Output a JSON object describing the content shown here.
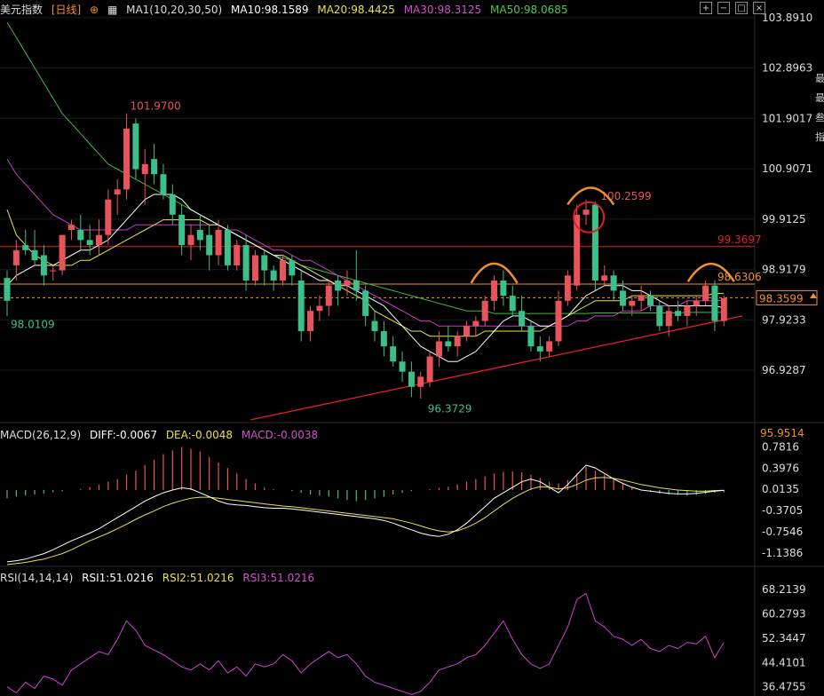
{
  "header": {
    "symbol": "美元指数",
    "period": "[日线]",
    "ma_label": "MA1(10,20,30,50)",
    "ma10": "MA10:98.1589",
    "ma20": "MA20:98.4425",
    "ma30": "MA30:98.3125",
    "ma50": "MA50:98.0685"
  },
  "macd_header": {
    "label": "MACD(26,12,9)",
    "diff": "DIFF:-0.0067",
    "dea": "DEA:-0.0048",
    "macd": "MACD:-0.0038"
  },
  "rsi_header": {
    "label": "RSI(14,14,14)",
    "rsi1": "RSI1:51.0216",
    "rsi2": "RSI2:51.0216",
    "rsi3": "RSI3:51.0216"
  },
  "colors": {
    "up": "#e8545c",
    "down": "#3dbf8a",
    "ma10": "#ffffff",
    "ma20": "#e6e34a",
    "ma30": "#c83cc8",
    "ma50": "#44b83c",
    "orange": "#f0902a",
    "level": "#e02020"
  },
  "toolbar_icons": [
    "expand-icon",
    "minimize-icon",
    "restore-icon",
    "close-icon"
  ],
  "side_chars": [
    "最",
    "最",
    "叁",
    "指"
  ],
  "chart_data": {
    "type": "candlestick",
    "price_ticks": [
      "103.8910",
      "102.8963",
      "101.9017",
      "100.9071",
      "99.9125",
      "98.9179",
      "97.9233",
      "96.9287"
    ],
    "price_range": [
      96.0,
      104.1
    ],
    "last_price": "98.3599",
    "annotations": {
      "high_1": "101.9700",
      "low_start": "98.0109",
      "low_main": "96.3729",
      "high_2": "100.2599",
      "level_red": "99.3697",
      "level_orange": "98.6306",
      "panel_bottom": "95.9514"
    },
    "levels": [
      99.3697,
      98.6306
    ],
    "candles": [
      [
        98.75,
        98.9,
        98.0,
        98.3
      ],
      [
        99.0,
        99.5,
        98.7,
        99.3
      ],
      [
        99.4,
        99.7,
        99.2,
        99.3
      ],
      [
        99.3,
        99.7,
        99.0,
        99.1
      ],
      [
        99.2,
        99.4,
        98.6,
        98.8
      ],
      [
        98.9,
        99.0,
        98.7,
        98.9
      ],
      [
        98.9,
        99.6,
        98.8,
        99.6
      ],
      [
        99.7,
        99.9,
        99.5,
        99.8
      ],
      [
        99.7,
        100.0,
        99.3,
        99.5
      ],
      [
        99.5,
        99.8,
        99.2,
        99.4
      ],
      [
        99.4,
        99.9,
        99.2,
        99.6
      ],
      [
        99.6,
        100.5,
        99.4,
        100.3
      ],
      [
        100.4,
        100.7,
        100.0,
        100.5
      ],
      [
        100.5,
        102.0,
        100.3,
        101.7
      ],
      [
        101.8,
        101.9,
        100.7,
        100.9
      ],
      [
        100.8,
        101.3,
        100.2,
        101.0
      ],
      [
        101.1,
        101.4,
        100.6,
        100.8
      ],
      [
        100.8,
        101.0,
        100.3,
        100.4
      ],
      [
        100.4,
        100.6,
        99.8,
        100.0
      ],
      [
        100.0,
        100.2,
        99.2,
        99.4
      ],
      [
        99.4,
        99.8,
        99.1,
        99.6
      ],
      [
        99.7,
        100.0,
        99.3,
        99.5
      ],
      [
        99.6,
        99.8,
        98.9,
        99.2
      ],
      [
        99.2,
        99.9,
        99.0,
        99.7
      ],
      [
        99.7,
        99.8,
        98.9,
        99.0
      ],
      [
        99.0,
        99.5,
        98.9,
        99.4
      ],
      [
        99.4,
        99.6,
        98.5,
        98.7
      ],
      [
        98.7,
        99.3,
        98.6,
        99.2
      ],
      [
        99.2,
        99.3,
        98.6,
        98.9
      ],
      [
        98.9,
        99.0,
        98.5,
        98.7
      ],
      [
        98.7,
        99.2,
        98.6,
        99.1
      ],
      [
        99.1,
        99.2,
        98.6,
        98.8
      ],
      [
        98.7,
        98.9,
        97.5,
        97.7
      ],
      [
        97.7,
        98.2,
        97.5,
        98.1
      ],
      [
        98.1,
        98.4,
        97.9,
        98.2
      ],
      [
        98.2,
        98.7,
        98.0,
        98.6
      ],
      [
        98.7,
        98.8,
        98.2,
        98.5
      ],
      [
        98.6,
        98.9,
        98.4,
        98.7
      ],
      [
        98.7,
        99.3,
        98.3,
        98.5
      ],
      [
        98.5,
        98.6,
        97.8,
        98.0
      ],
      [
        97.9,
        98.1,
        97.5,
        97.7
      ],
      [
        97.7,
        97.9,
        97.2,
        97.4
      ],
      [
        97.4,
        97.6,
        97.0,
        97.1
      ],
      [
        97.1,
        97.3,
        96.7,
        96.9
      ],
      [
        96.9,
        97.1,
        96.4,
        96.6
      ],
      [
        96.6,
        96.9,
        96.37,
        96.8
      ],
      [
        96.7,
        97.3,
        96.6,
        97.2
      ],
      [
        97.2,
        97.7,
        97.0,
        97.5
      ],
      [
        97.5,
        97.8,
        97.3,
        97.4
      ],
      [
        97.4,
        97.7,
        97.2,
        97.6
      ],
      [
        97.6,
        97.9,
        97.5,
        97.8
      ],
      [
        97.8,
        98.0,
        97.6,
        97.9
      ],
      [
        97.9,
        98.4,
        97.8,
        98.3
      ],
      [
        98.3,
        98.8,
        98.1,
        98.7
      ],
      [
        98.7,
        98.9,
        98.2,
        98.4
      ],
      [
        98.4,
        98.6,
        98.0,
        98.1
      ],
      [
        98.1,
        98.4,
        97.7,
        97.8
      ],
      [
        97.8,
        97.9,
        97.3,
        97.4
      ],
      [
        97.4,
        97.6,
        97.1,
        97.3
      ],
      [
        97.3,
        97.6,
        97.2,
        97.5
      ],
      [
        97.5,
        98.5,
        97.4,
        98.3
      ],
      [
        98.3,
        98.9,
        98.2,
        98.8
      ],
      [
        98.6,
        100.2,
        98.5,
        100.0
      ],
      [
        100.0,
        100.3,
        99.8,
        100.1
      ],
      [
        100.2,
        100.26,
        98.5,
        98.7
      ],
      [
        98.7,
        99.0,
        98.6,
        98.8
      ],
      [
        98.8,
        98.9,
        98.3,
        98.5
      ],
      [
        98.5,
        98.7,
        98.1,
        98.2
      ],
      [
        98.2,
        98.4,
        98.0,
        98.3
      ],
      [
        98.3,
        98.6,
        98.1,
        98.4
      ],
      [
        98.4,
        98.5,
        98.1,
        98.2
      ],
      [
        98.2,
        98.3,
        97.7,
        97.8
      ],
      [
        97.8,
        98.2,
        97.6,
        98.1
      ],
      [
        98.1,
        98.3,
        97.9,
        98.0
      ],
      [
        98.0,
        98.3,
        97.8,
        98.2
      ],
      [
        98.2,
        98.4,
        98.0,
        98.3
      ],
      [
        98.3,
        98.7,
        98.2,
        98.6
      ],
      [
        98.6,
        98.7,
        97.7,
        97.9
      ],
      [
        97.9,
        98.4,
        97.8,
        98.35
      ]
    ],
    "ma10": [
      98.6,
      98.8,
      98.9,
      99.0,
      99.0,
      99.0,
      99.1,
      99.2,
      99.3,
      99.3,
      99.4,
      99.5,
      99.7,
      99.9,
      100.1,
      100.3,
      100.4,
      100.4,
      100.4,
      100.3,
      100.1,
      100.0,
      99.9,
      99.8,
      99.7,
      99.6,
      99.5,
      99.4,
      99.3,
      99.2,
      99.1,
      99.0,
      98.9,
      98.8,
      98.7,
      98.7,
      98.6,
      98.6,
      98.5,
      98.4,
      98.3,
      98.2,
      98.0,
      97.8,
      97.6,
      97.4,
      97.3,
      97.2,
      97.1,
      97.1,
      97.2,
      97.3,
      97.5,
      97.7,
      97.9,
      98.0,
      98.0,
      97.9,
      97.8,
      97.8,
      97.9,
      98.0,
      98.2,
      98.4,
      98.5,
      98.6,
      98.6,
      98.6,
      98.5,
      98.5,
      98.4,
      98.3,
      98.2,
      98.2,
      98.2,
      98.2,
      98.2,
      98.2,
      98.16
    ],
    "ma20": [
      100.1,
      99.6,
      99.4,
      99.2,
      99.1,
      99.0,
      99.0,
      99.0,
      99.1,
      99.1,
      99.2,
      99.3,
      99.4,
      99.5,
      99.6,
      99.7,
      99.8,
      99.9,
      99.9,
      99.9,
      99.9,
      99.9,
      99.8,
      99.8,
      99.7,
      99.6,
      99.5,
      99.4,
      99.3,
      99.2,
      99.2,
      99.1,
      99.0,
      98.9,
      98.8,
      98.7,
      98.6,
      98.5,
      98.4,
      98.3,
      98.1,
      98.0,
      97.9,
      97.8,
      97.7,
      97.7,
      97.6,
      97.6,
      97.6,
      97.6,
      97.6,
      97.6,
      97.7,
      97.7,
      97.7,
      97.7,
      97.7,
      97.7,
      97.7,
      97.8,
      97.9,
      98.0,
      98.1,
      98.2,
      98.3,
      98.3,
      98.3,
      98.3,
      98.4,
      98.4,
      98.4,
      98.4,
      98.4,
      98.4,
      98.4,
      98.4,
      98.4,
      98.45,
      98.44
    ],
    "ma30": [
      101.1,
      100.8,
      100.6,
      100.4,
      100.2,
      100.0,
      99.9,
      99.8,
      99.7,
      99.7,
      99.7,
      99.7,
      99.7,
      99.7,
      99.8,
      99.8,
      99.8,
      99.8,
      99.8,
      99.8,
      99.8,
      99.8,
      99.8,
      99.8,
      99.7,
      99.7,
      99.6,
      99.5,
      99.4,
      99.3,
      99.3,
      99.2,
      99.1,
      99.1,
      99.0,
      98.9,
      98.8,
      98.7,
      98.6,
      98.5,
      98.4,
      98.3,
      98.2,
      98.1,
      98.0,
      97.9,
      97.9,
      97.8,
      97.8,
      97.8,
      97.8,
      97.8,
      97.8,
      97.8,
      97.8,
      97.8,
      97.8,
      97.8,
      97.8,
      97.8,
      97.8,
      97.8,
      97.9,
      97.9,
      98.0,
      98.0,
      98.0,
      98.1,
      98.1,
      98.1,
      98.2,
      98.2,
      98.2,
      98.2,
      98.3,
      98.3,
      98.3,
      98.3,
      98.31
    ],
    "ma50": [
      103.8,
      103.5,
      103.2,
      102.9,
      102.6,
      102.3,
      102.0,
      101.8,
      101.6,
      101.4,
      101.2,
      101.0,
      100.9,
      100.8,
      100.7,
      100.6,
      100.5,
      100.4,
      100.3,
      100.2,
      100.1,
      100.0,
      99.9,
      99.8,
      99.7,
      99.6,
      99.5,
      99.4,
      99.3,
      99.2,
      99.15,
      99.1,
      99.0,
      98.95,
      98.9,
      98.85,
      98.8,
      98.75,
      98.7,
      98.65,
      98.6,
      98.55,
      98.5,
      98.45,
      98.4,
      98.35,
      98.3,
      98.25,
      98.2,
      98.15,
      98.1,
      98.1,
      98.1,
      98.05,
      98.05,
      98.05,
      98.05,
      98.05,
      98.05,
      98.05,
      98.05,
      98.05,
      98.05,
      98.05,
      98.06,
      98.06,
      98.06,
      98.06,
      98.06,
      98.06,
      98.06,
      98.06,
      98.06,
      98.06,
      98.07,
      98.07,
      98.07,
      98.07,
      98.07
    ],
    "macd_ticks": [
      "0.7816",
      "0.3976",
      "0.0135",
      "-0.3705",
      "-0.7546",
      "-1.1386"
    ],
    "macd_range": [
      -1.35,
      0.9
    ],
    "macd_hist": [
      -0.15,
      -0.12,
      -0.1,
      -0.08,
      -0.06,
      -0.04,
      -0.02,
      0.0,
      0.02,
      0.05,
      0.1,
      0.15,
      0.2,
      0.28,
      0.35,
      0.45,
      0.55,
      0.65,
      0.72,
      0.78,
      0.75,
      0.7,
      0.6,
      0.5,
      0.4,
      0.3,
      0.2,
      0.12,
      0.05,
      0.02,
      0.0,
      -0.02,
      -0.05,
      -0.08,
      -0.1,
      -0.12,
      -0.15,
      -0.18,
      -0.2,
      -0.18,
      -0.15,
      -0.12,
      -0.08,
      -0.05,
      -0.02,
      0.0,
      0.02,
      0.04,
      0.06,
      0.1,
      0.15,
      0.2,
      0.25,
      0.3,
      0.33,
      0.34,
      0.32,
      0.28,
      0.22,
      0.15,
      0.12,
      0.18,
      0.3,
      0.42,
      0.35,
      0.28,
      0.2,
      0.12,
      0.05,
      0.0,
      -0.03,
      -0.06,
      -0.08,
      -0.09,
      -0.1,
      -0.09,
      -0.07,
      -0.05,
      -0.04
    ],
    "macd_diff": [
      -1.3,
      -1.28,
      -1.25,
      -1.2,
      -1.15,
      -1.08,
      -1.0,
      -0.92,
      -0.85,
      -0.78,
      -0.7,
      -0.6,
      -0.5,
      -0.4,
      -0.3,
      -0.2,
      -0.12,
      -0.05,
      0.0,
      0.04,
      0.02,
      -0.05,
      -0.12,
      -0.2,
      -0.25,
      -0.27,
      -0.28,
      -0.3,
      -0.32,
      -0.33,
      -0.33,
      -0.34,
      -0.36,
      -0.38,
      -0.4,
      -0.42,
      -0.44,
      -0.46,
      -0.48,
      -0.5,
      -0.52,
      -0.55,
      -0.6,
      -0.66,
      -0.72,
      -0.78,
      -0.82,
      -0.84,
      -0.8,
      -0.72,
      -0.6,
      -0.45,
      -0.3,
      -0.15,
      -0.05,
      0.05,
      0.15,
      0.2,
      0.15,
      0.05,
      -0.05,
      0.1,
      0.28,
      0.45,
      0.4,
      0.3,
      0.2,
      0.12,
      0.05,
      0.0,
      -0.02,
      -0.04,
      -0.06,
      -0.07,
      -0.07,
      -0.06,
      -0.04,
      -0.02,
      -0.0067
    ],
    "macd_dea": [
      -1.35,
      -1.33,
      -1.31,
      -1.28,
      -1.25,
      -1.2,
      -1.15,
      -1.08,
      -1.0,
      -0.92,
      -0.85,
      -0.78,
      -0.7,
      -0.62,
      -0.53,
      -0.45,
      -0.38,
      -0.3,
      -0.24,
      -0.19,
      -0.15,
      -0.13,
      -0.13,
      -0.15,
      -0.17,
      -0.19,
      -0.21,
      -0.23,
      -0.25,
      -0.27,
      -0.29,
      -0.3,
      -0.32,
      -0.34,
      -0.36,
      -0.38,
      -0.4,
      -0.42,
      -0.44,
      -0.46,
      -0.48,
      -0.5,
      -0.52,
      -0.56,
      -0.6,
      -0.65,
      -0.7,
      -0.74,
      -0.76,
      -0.74,
      -0.68,
      -0.6,
      -0.5,
      -0.38,
      -0.26,
      -0.15,
      -0.06,
      0.02,
      0.06,
      0.05,
      0.02,
      0.04,
      0.1,
      0.18,
      0.22,
      0.23,
      0.21,
      0.18,
      0.14,
      0.1,
      0.07,
      0.04,
      0.02,
      0.0,
      -0.01,
      -0.02,
      -0.02,
      -0.01,
      -0.0048
    ],
    "rsi_ticks": [
      "68.2139",
      "60.2793",
      "52.3447",
      "44.4101",
      "36.4755"
    ],
    "rsi_range": [
      33.5,
      70.0
    ],
    "rsi": [
      36.5,
      34.5,
      38.0,
      36.0,
      40.0,
      39.0,
      37.0,
      42.0,
      44.0,
      46.0,
      48.0,
      47.0,
      52.0,
      58.0,
      55.0,
      50.0,
      48.5,
      47.0,
      45.0,
      43.0,
      42.0,
      44.0,
      42.0,
      45.0,
      41.0,
      43.0,
      40.0,
      44.0,
      43.0,
      44.0,
      47.0,
      45.0,
      41.0,
      44.0,
      46.0,
      48.0,
      46.0,
      47.0,
      44.0,
      40.0,
      38.0,
      37.0,
      36.0,
      35.0,
      34.0,
      35.0,
      38.0,
      42.0,
      43.0,
      44.0,
      46.0,
      47.0,
      50.0,
      54.0,
      58.0,
      52.0,
      47.0,
      44.0,
      42.5,
      44.0,
      50.0,
      56.0,
      65.0,
      67.0,
      58.0,
      56.0,
      53.0,
      52.0,
      50.0,
      52.0,
      49.0,
      48.0,
      50.0,
      49.0,
      51.0,
      50.5,
      53.0,
      46.0,
      51.0
    ]
  }
}
